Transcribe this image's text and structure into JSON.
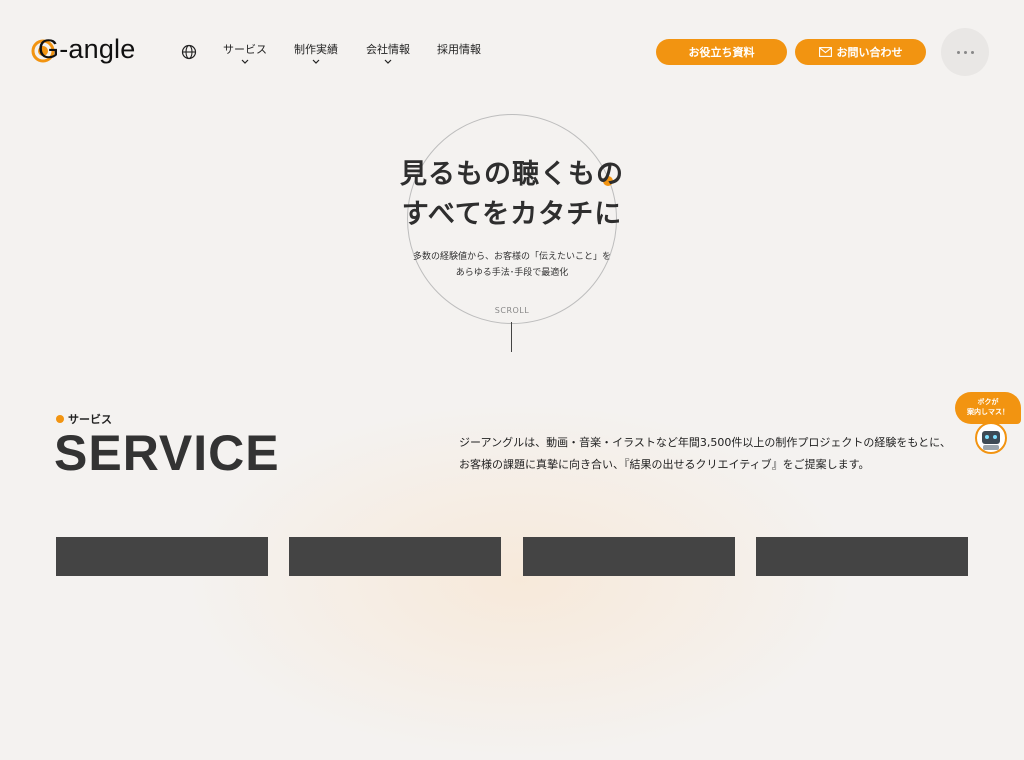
{
  "header": {
    "logo_text": "G-angle",
    "nav": [
      {
        "label": "サービス",
        "has_dropdown": true
      },
      {
        "label": "制作実績",
        "has_dropdown": true
      },
      {
        "label": "会社情報",
        "has_dropdown": true
      },
      {
        "label": "採用情報",
        "has_dropdown": false
      }
    ],
    "docs_button": "お役立ち資料",
    "contact_button": "お問い合わせ"
  },
  "hero": {
    "title_line1": "見るもの聴くもの",
    "title_line2": "すべてをカタチに",
    "sub_line1": "多数の経験値から、お客様の「伝えたいこと」を",
    "sub_line2": "あらゆる手法･手段で最適化",
    "scroll": "SCROLL"
  },
  "service": {
    "tag": "サービス",
    "title": "SERVICE",
    "desc_line1": "ジーアングルは、動画・音楽・イラストなど年間3,500件以上の制作プロジェクトの経験をもとに、",
    "desc_line2": "お客様の課題に真摯に向き合い、『結果の出せるクリエイティブ』をご提案します。"
  },
  "guide": {
    "line1": "ボクが",
    "line2": "案内しマス！"
  },
  "colors": {
    "accent": "#f29411",
    "background": "#f4f2f0",
    "card": "#444444"
  }
}
